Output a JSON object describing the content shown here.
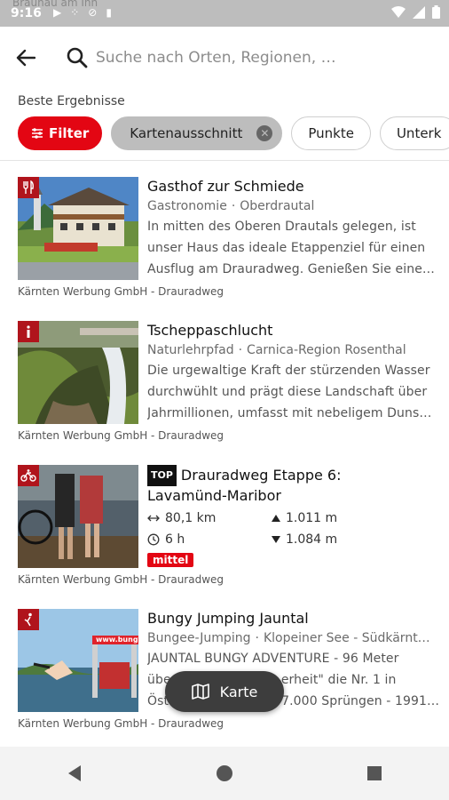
{
  "status_bar": {
    "time": "9:16",
    "background_text": "Braunau am Inn"
  },
  "search": {
    "placeholder": "Suche nach Orten, Regionen, …",
    "value": ""
  },
  "results_label": "Beste Ergebnisse",
  "chips": {
    "filter_label": "Filter",
    "active_label": "Kartenausschnitt",
    "items": [
      "Punkte",
      "Unterk"
    ]
  },
  "results": [
    {
      "title": "Gasthof zur Schmiede",
      "category": "Gastronomie",
      "region": "Oberdrautal",
      "description": [
        "In mitten des Oberen Drautals gelegen, ist",
        "unser Haus das ideale Etappenziel für einen",
        "Ausflug am Drauradweg. Genießen Sie eine…"
      ],
      "source": "Kärnten Werbung GmbH - Drauradweg",
      "badge_icon": "restaurant-icon"
    },
    {
      "title": "Tscheppaschlucht",
      "category": "Naturlehrpfad",
      "region": "Carnica-Region Rosenthal",
      "description": [
        "Die urgewaltige Kraft der stürzenden Wasser",
        "durchwühlt und prägt diese Landschaft über",
        "Jahrmillionen, umfasst mit nebeligem Duns…"
      ],
      "source": "Kärnten Werbung GmbH - Drauradweg",
      "badge_icon": "info-icon"
    },
    {
      "top_label": "TOP",
      "title_line1": "Drauradweg Etappe 6:",
      "title_line2": "Lavamünd-Maribor",
      "distance": "80,1 km",
      "ascent": "1.011 m",
      "duration": "6 h",
      "descent": "1.084 m",
      "difficulty": "mittel",
      "source": "Kärnten Werbung GmbH - Drauradweg",
      "badge_icon": "bicycle-icon"
    },
    {
      "title": "Bungy Jumping Jauntal",
      "category": "Bungee-Jumping",
      "region": "Klopeiner See - Südkärnt…",
      "description": [
        "JAUNTAL BUNGY ADVENTURE - 96 Meter",
        "über                          erheit\" die Nr. 1 in",
        "Öste                          7.000 Sprüngen - 1991…"
      ],
      "source": "Kärnten Werbung GmbH - Drauradweg",
      "badge_icon": "jump-icon",
      "thumb_text": "www.bungy"
    }
  ],
  "map_button_label": "Karte",
  "colors": {
    "accent": "#e30613",
    "badge": "#b0141c"
  }
}
